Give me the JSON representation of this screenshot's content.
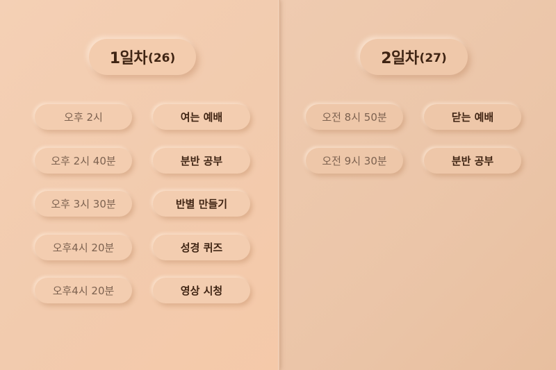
{
  "day1": {
    "title": "1일차",
    "count": "(26)",
    "items": [
      {
        "time": "오후 2시",
        "activity": "여는 예배"
      },
      {
        "time": "오후 2시 40분",
        "activity": "분반 공부"
      },
      {
        "time": "오후 3시 30분",
        "activity": "반별 만들기"
      },
      {
        "time": "오후4시 20분",
        "activity": "성경 퀴즈"
      },
      {
        "time": "오후4시 20분",
        "activity": "영상 시청"
      }
    ]
  },
  "day2": {
    "title": "2일차",
    "count": "(27)",
    "items": [
      {
        "time": "오전 8시 50분",
        "activity": "닫는 예배"
      },
      {
        "time": "오전 9시 30분",
        "activity": "분반 공부"
      }
    ]
  },
  "colors": {
    "background_left": "#f3ceb2",
    "background_right": "#ecc6a9",
    "text_dark": "#3f2413",
    "text_muted": "#7d6250"
  }
}
